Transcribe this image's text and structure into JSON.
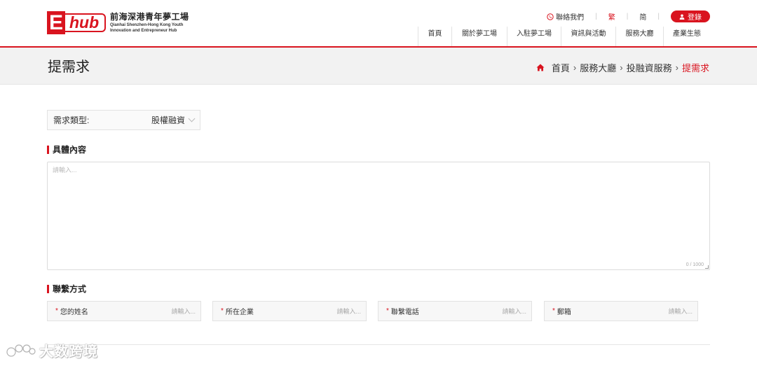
{
  "header": {
    "logo": {
      "mark_e": "E",
      "mark_hub": "hub",
      "name_cn": "前海深港青年夢工場",
      "name_en_line1": "Qianhai Shenzhen-Hong Kong Youth",
      "name_en_line2": "Innovation and Entrepreneur Hub"
    },
    "contact_label": "聯絡我們",
    "lang_traditional": "繁",
    "lang_simplified": "简",
    "login_label": "登錄",
    "nav": [
      {
        "label": "首頁"
      },
      {
        "label": "關於夢工場"
      },
      {
        "label": "入駐夢工場"
      },
      {
        "label": "資訊與活動"
      },
      {
        "label": "服務大廳"
      },
      {
        "label": "產業生態"
      }
    ]
  },
  "titlebar": {
    "title": "提需求",
    "breadcrumb": [
      "首頁",
      "服務大廳",
      "投融資服務",
      "提需求"
    ]
  },
  "form": {
    "type_label": "需求類型:",
    "type_value": "股權融資",
    "content_section": "具體內容",
    "content_placeholder": "請輸入...",
    "content_counter": "0 / 1000",
    "contact_section": "聯繫方式",
    "fields": [
      {
        "label": "您的姓名",
        "placeholder": "請輸入..."
      },
      {
        "label": "所在企業",
        "placeholder": "請輸入..."
      },
      {
        "label": "聯繫電話",
        "placeholder": "請輸入..."
      },
      {
        "label": "郵箱",
        "placeholder": "請輸入..."
      }
    ],
    "required_mark": "*"
  },
  "watermark": {
    "text": "大数跨境"
  },
  "colors": {
    "accent": "#d9141f",
    "titlebar_bg": "#f2f2f2"
  }
}
